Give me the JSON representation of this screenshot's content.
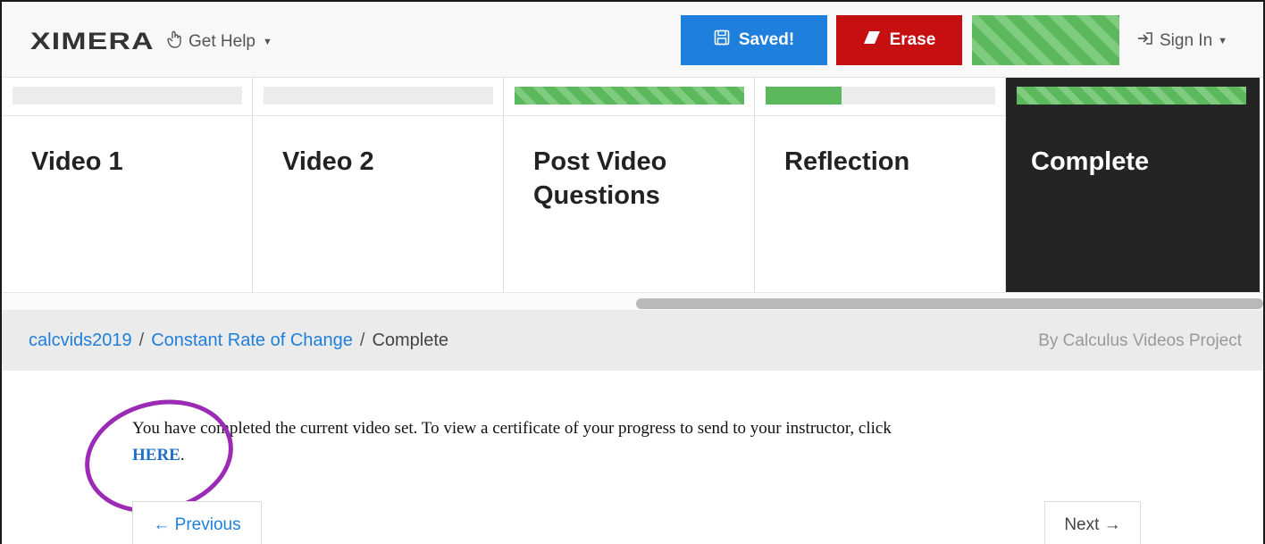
{
  "navbar": {
    "logo": "XIMERA",
    "get_help": "Get Help",
    "saved_label": "Saved!",
    "erase_label": "Erase",
    "sign_in": "Sign In"
  },
  "cards": [
    {
      "title": "Video 1",
      "progress": 0
    },
    {
      "title": "Video 2",
      "progress": 0
    },
    {
      "title": "Post Video Questions",
      "progress": 1.0
    },
    {
      "title": "Reflection",
      "progress": 0.33
    },
    {
      "title": "Complete",
      "progress": 1.0,
      "active": true
    }
  ],
  "breadcrumb": {
    "course": "calcvids2019",
    "section": "Constant Rate of Change",
    "current": "Complete",
    "byline": "By Calculus Videos Project"
  },
  "content": {
    "message": "You have completed the current video set. To view a certificate of your progress to send to your instructor, click",
    "link_text": "HERE",
    "trailing": "."
  },
  "nav_buttons": {
    "previous": "← Previous",
    "next": "Next →"
  },
  "colors": {
    "primary": "#1e7fdc",
    "danger": "#c60f10",
    "success": "#5cb85c",
    "annotation": "#9b2bb5"
  }
}
